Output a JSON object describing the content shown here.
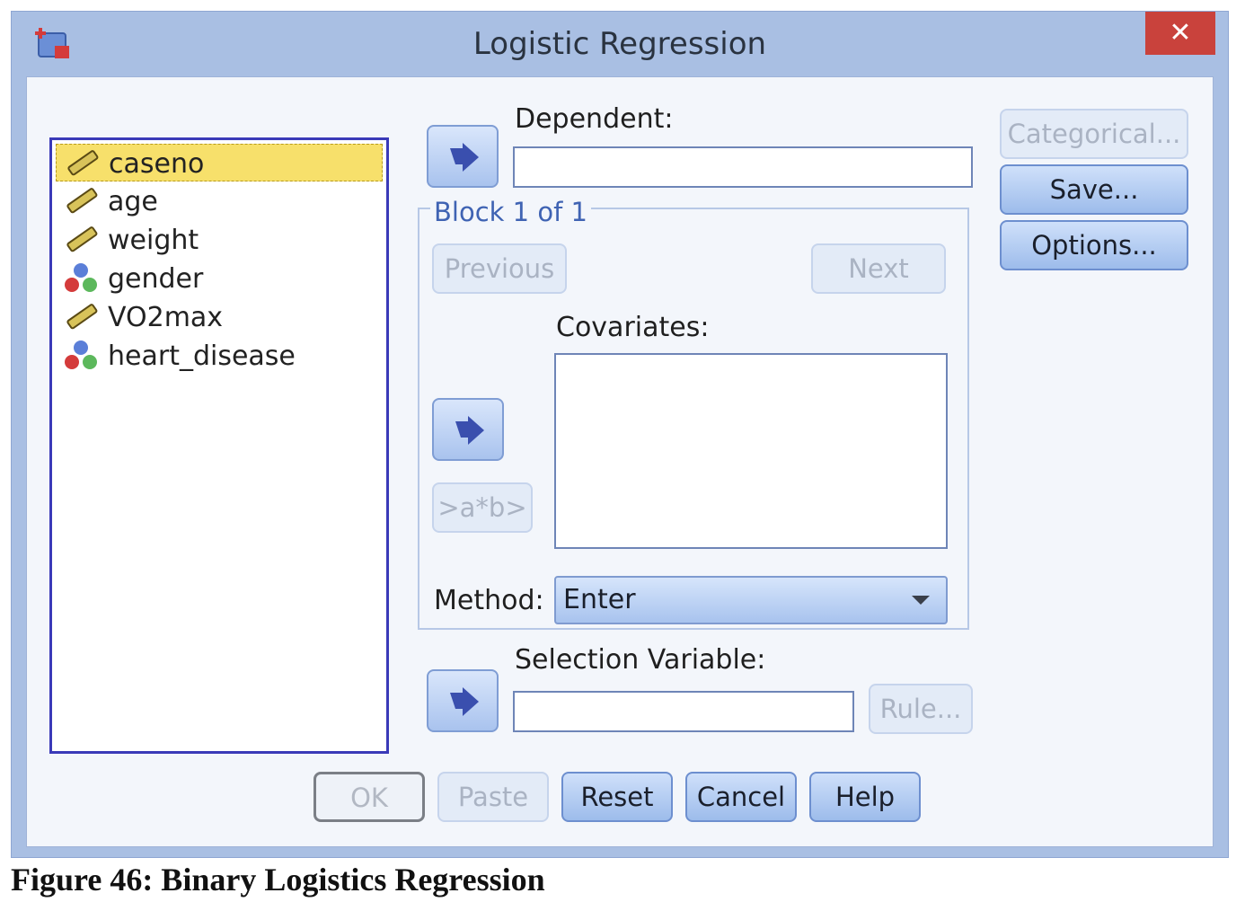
{
  "window": {
    "title": "Logistic Regression",
    "close_label": "✕"
  },
  "variables": [
    {
      "name": "caseno",
      "type": "scale",
      "selected": true
    },
    {
      "name": "age",
      "type": "scale",
      "selected": false
    },
    {
      "name": "weight",
      "type": "scale",
      "selected": false
    },
    {
      "name": "gender",
      "type": "nominal",
      "selected": false
    },
    {
      "name": "VO2max",
      "type": "scale",
      "selected": false
    },
    {
      "name": "heart_disease",
      "type": "nominal",
      "selected": false
    }
  ],
  "dependent": {
    "label": "Dependent:",
    "value": ""
  },
  "block": {
    "label": "Block 1 of 1",
    "previous": "Previous",
    "next": "Next"
  },
  "covariates": {
    "label": "Covariates:",
    "interaction_button": ">a*b>"
  },
  "method": {
    "label": "Method:",
    "value": "Enter"
  },
  "selection": {
    "label": "Selection Variable:",
    "value": "",
    "rule_button": "Rule..."
  },
  "side_buttons": {
    "categorical": "Categorical...",
    "save": "Save...",
    "options": "Options..."
  },
  "bottom_buttons": {
    "ok": "OK",
    "paste": "Paste",
    "reset": "Reset",
    "cancel": "Cancel",
    "help": "Help"
  },
  "caption": "Figure 46: Binary Logistics Regression"
}
